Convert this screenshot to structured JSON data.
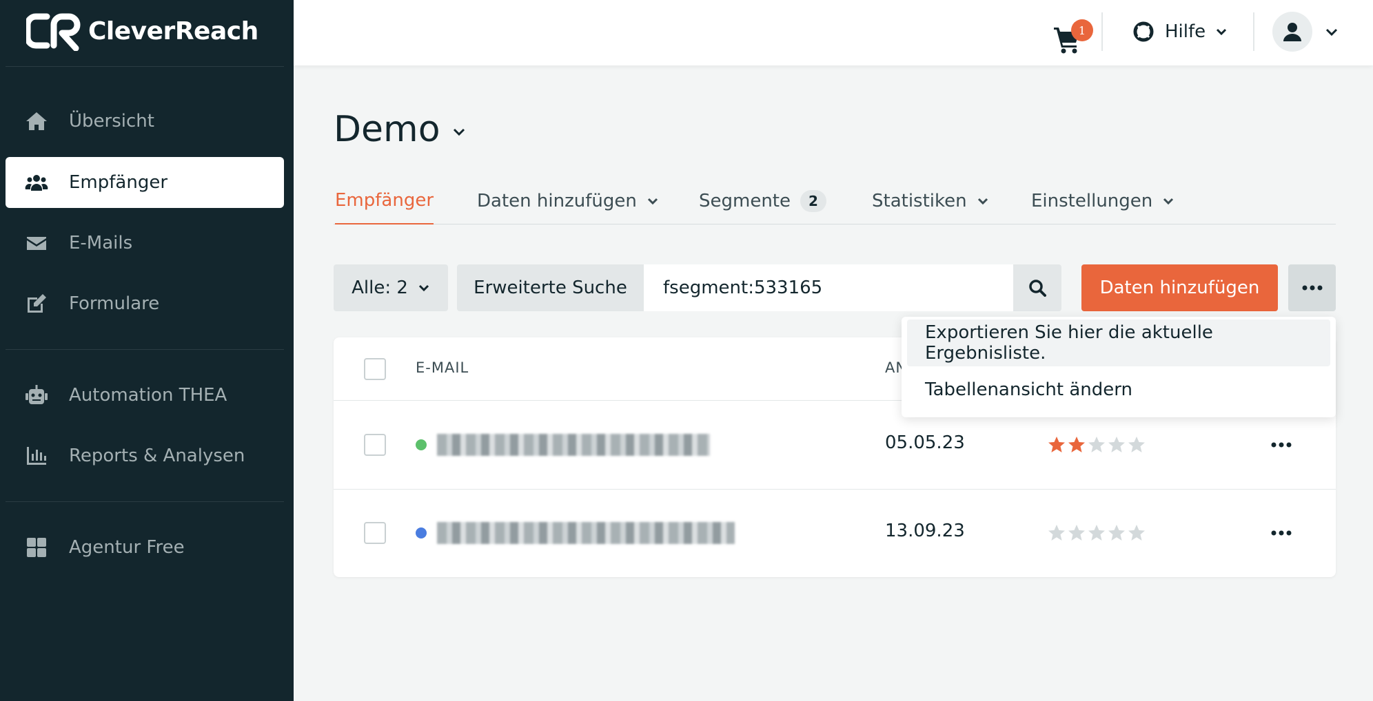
{
  "brand": {
    "name": "CleverReach"
  },
  "sidebar": {
    "items": [
      {
        "label": "Übersicht",
        "icon": "home-icon",
        "active": false
      },
      {
        "label": "Empfänger",
        "icon": "users-icon",
        "active": true
      },
      {
        "label": "E-Mails",
        "icon": "envelope-icon",
        "active": false
      },
      {
        "label": "Formulare",
        "icon": "edit-icon",
        "active": false
      },
      {
        "label": "Automation THEA",
        "icon": "robot-icon",
        "active": false
      },
      {
        "label": "Reports & Analysen",
        "icon": "bar-chart-icon",
        "active": false
      },
      {
        "label": "Agentur Free",
        "icon": "grid-icon",
        "active": false
      }
    ]
  },
  "topbar": {
    "cart_count": "1",
    "help_label": "Hilfe"
  },
  "page": {
    "title": "Demo"
  },
  "tabs": [
    {
      "label": "Empfänger",
      "active": true
    },
    {
      "label": "Daten hinzufügen",
      "dropdown": true
    },
    {
      "label": "Segmente",
      "count": "2"
    },
    {
      "label": "Statistiken",
      "dropdown": true
    },
    {
      "label": "Einstellungen",
      "dropdown": true
    }
  ],
  "toolbar": {
    "filter_label": "Alle: 2",
    "advanced_search_label": "Erweiterte Suche",
    "search_value": "fsegment:533165",
    "add_data_label": "Daten hinzufügen"
  },
  "dropdown_menu": {
    "items": [
      "Exportieren Sie hier die aktuelle Ergebnisliste.",
      "Tabellenansicht ändern"
    ]
  },
  "table": {
    "columns": [
      "E-MAIL",
      "AN"
    ],
    "rows": [
      {
        "status_color": "#5cc06b",
        "date": "05.05.23",
        "rating": 2
      },
      {
        "status_color": "#4a7de0",
        "date": "13.09.23",
        "rating": 0
      }
    ]
  },
  "colors": {
    "accent": "#e9663c",
    "sidebar_bg": "#13262d",
    "star_inactive": "#d3d9db"
  }
}
